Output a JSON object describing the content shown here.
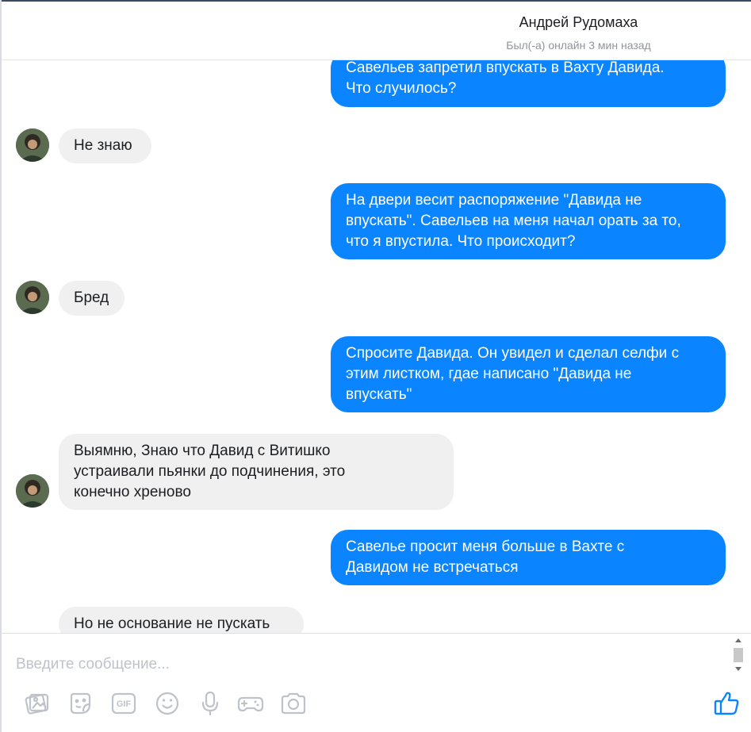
{
  "header": {
    "contact_name": "Андрей Рудомаха",
    "status": "Был(-а) онлайн 3 мин назад"
  },
  "messages": [
    {
      "direction": "out",
      "lines": [
        "Савельев запретил впускать в Вахту Давида.",
        "Что случилось?"
      ]
    },
    {
      "direction": "in",
      "lines": [
        "Не знаю"
      ]
    },
    {
      "direction": "out",
      "lines": [
        "На двери весит распоряжение \"Давида не",
        "впускать\". Савельев на меня начал орать за то,",
        "что я впустила. Что происходит?"
      ]
    },
    {
      "direction": "in",
      "lines": [
        "Бред"
      ]
    },
    {
      "direction": "out",
      "lines": [
        "Спросите Давида. Он увидел и сделал селфи с",
        "этим листком, гдае написано \"Давида не",
        "впускать\""
      ]
    },
    {
      "direction": "in",
      "lines": [
        "Выямню, Знаю что Давид с Витишко",
        "устраивали пьянки до подчинения, это",
        "конечно хреново"
      ]
    },
    {
      "direction": "out",
      "lines": [
        "Савелье просит меня больше в Вахте с",
        "Давидом не встречаться"
      ]
    },
    {
      "direction": "in",
      "lines": [
        "Но не основание не пускать"
      ]
    }
  ],
  "composer": {
    "placeholder": "Введите сообщение...",
    "gif_label": "GIF",
    "icons": [
      "photo-icon",
      "sticker-icon",
      "gif-icon",
      "emoji-icon",
      "microphone-icon",
      "game-controller-icon",
      "camera-icon",
      "like-icon"
    ]
  },
  "colors": {
    "outgoing_bubble": "#0b84ff",
    "incoming_bubble": "#f0f0f0",
    "icon_gray": "#bec3c9",
    "like_blue": "#0b84ff"
  }
}
